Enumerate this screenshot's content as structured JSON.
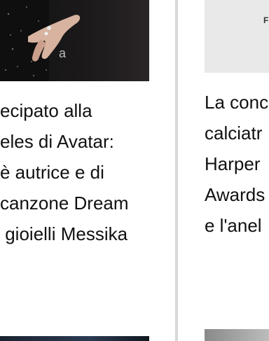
{
  "left_card": {
    "image_alt": "photo",
    "caption_lines": [
      "ecipato alla",
      "eles di Avatar:",
      "è autrice e di",
      "canzone Dream",
      " gioielli Messika"
    ]
  },
  "right_card": {
    "image_letter": "F",
    "caption_lines": [
      "La conc",
      "calciatr",
      "Harper",
      "Awards",
      "e l'anel"
    ]
  }
}
